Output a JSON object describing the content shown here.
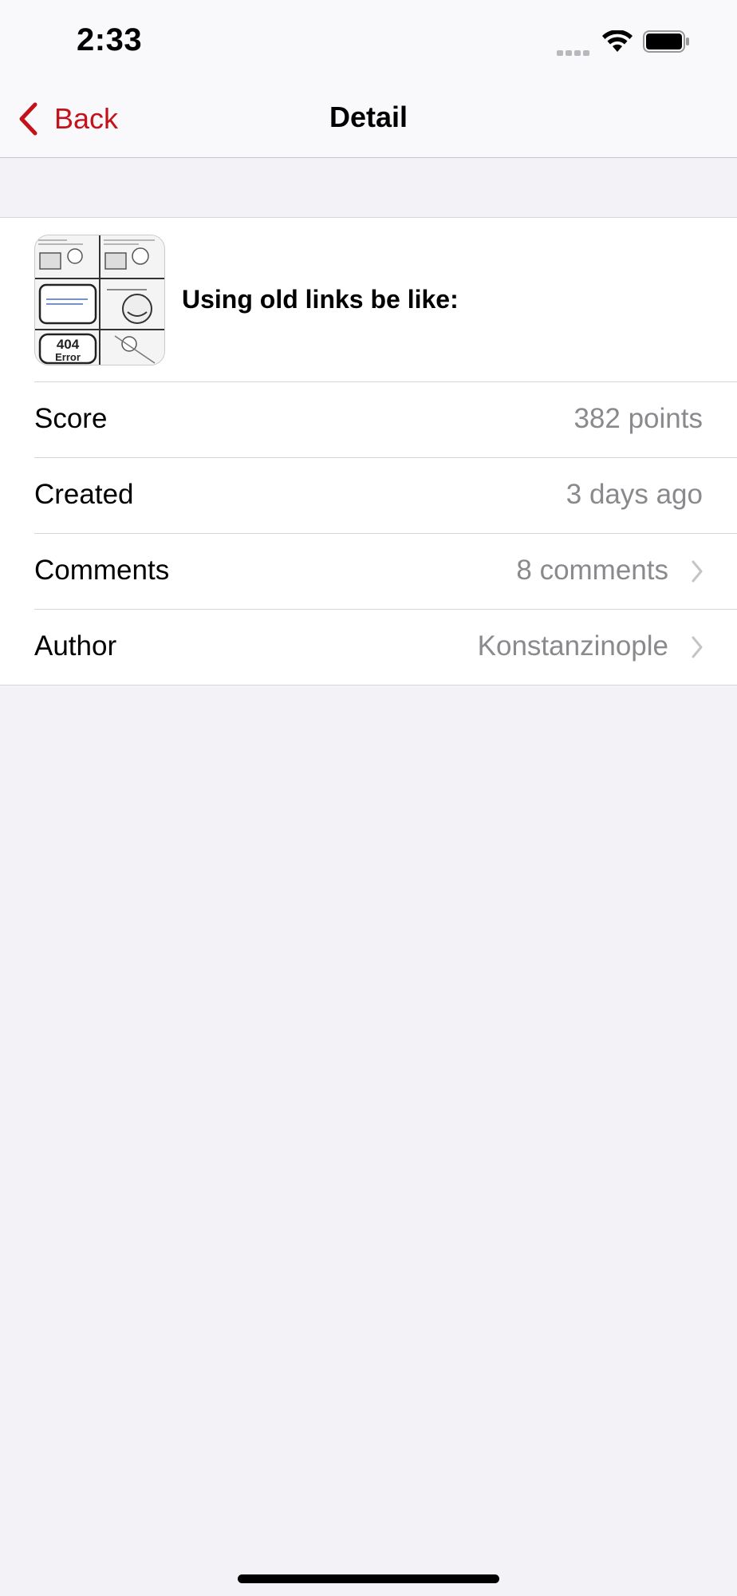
{
  "status_bar": {
    "time": "2:33",
    "icons": [
      "signal-icon",
      "wifi-icon",
      "battery-icon"
    ]
  },
  "nav": {
    "back_label": "Back",
    "title": "Detail",
    "accent_color": "#c4121b"
  },
  "post": {
    "title": "Using old links be like:",
    "thumbnail_text": "404 Error"
  },
  "rows": [
    {
      "label": "Score",
      "value": "382 points",
      "disclosure": false
    },
    {
      "label": "Created",
      "value": "3 days ago",
      "disclosure": false
    },
    {
      "label": "Comments",
      "value": "8 comments",
      "disclosure": true
    },
    {
      "label": "Author",
      "value": "Konstanzinople",
      "disclosure": true
    }
  ]
}
